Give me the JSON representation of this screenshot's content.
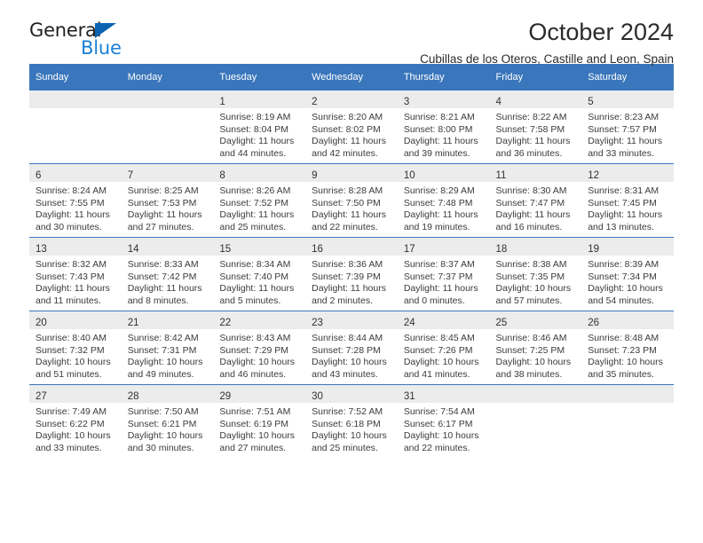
{
  "brand": {
    "name_top": "General",
    "name_bottom": "Blue",
    "triangle_icon": "triangle-icon",
    "colors": {
      "dark": "#231f20",
      "blue": "#1b7fd4",
      "triangle": "#0c63b0"
    }
  },
  "header": {
    "title": "October 2024",
    "subtitle": "Cubillas de los Oteros, Castille and Leon, Spain"
  },
  "theme": {
    "header_bg": "#3a76bb",
    "header_text": "#ffffff",
    "row_divider": "#3a76bb",
    "daynum_shade": "#ececec",
    "body_text": "#3b3b3b"
  },
  "calendar": {
    "weekday_headers": [
      "Sunday",
      "Monday",
      "Tuesday",
      "Wednesday",
      "Thursday",
      "Friday",
      "Saturday"
    ],
    "weeks": [
      [
        {
          "day": "",
          "lines": []
        },
        {
          "day": "",
          "lines": []
        },
        {
          "day": "1",
          "lines": [
            "Sunrise: 8:19 AM",
            "Sunset: 8:04 PM",
            "Daylight: 11 hours",
            "and 44 minutes."
          ]
        },
        {
          "day": "2",
          "lines": [
            "Sunrise: 8:20 AM",
            "Sunset: 8:02 PM",
            "Daylight: 11 hours",
            "and 42 minutes."
          ]
        },
        {
          "day": "3",
          "lines": [
            "Sunrise: 8:21 AM",
            "Sunset: 8:00 PM",
            "Daylight: 11 hours",
            "and 39 minutes."
          ]
        },
        {
          "day": "4",
          "lines": [
            "Sunrise: 8:22 AM",
            "Sunset: 7:58 PM",
            "Daylight: 11 hours",
            "and 36 minutes."
          ]
        },
        {
          "day": "5",
          "lines": [
            "Sunrise: 8:23 AM",
            "Sunset: 7:57 PM",
            "Daylight: 11 hours",
            "and 33 minutes."
          ]
        }
      ],
      [
        {
          "day": "6",
          "lines": [
            "Sunrise: 8:24 AM",
            "Sunset: 7:55 PM",
            "Daylight: 11 hours",
            "and 30 minutes."
          ]
        },
        {
          "day": "7",
          "lines": [
            "Sunrise: 8:25 AM",
            "Sunset: 7:53 PM",
            "Daylight: 11 hours",
            "and 27 minutes."
          ]
        },
        {
          "day": "8",
          "lines": [
            "Sunrise: 8:26 AM",
            "Sunset: 7:52 PM",
            "Daylight: 11 hours",
            "and 25 minutes."
          ]
        },
        {
          "day": "9",
          "lines": [
            "Sunrise: 8:28 AM",
            "Sunset: 7:50 PM",
            "Daylight: 11 hours",
            "and 22 minutes."
          ]
        },
        {
          "day": "10",
          "lines": [
            "Sunrise: 8:29 AM",
            "Sunset: 7:48 PM",
            "Daylight: 11 hours",
            "and 19 minutes."
          ]
        },
        {
          "day": "11",
          "lines": [
            "Sunrise: 8:30 AM",
            "Sunset: 7:47 PM",
            "Daylight: 11 hours",
            "and 16 minutes."
          ]
        },
        {
          "day": "12",
          "lines": [
            "Sunrise: 8:31 AM",
            "Sunset: 7:45 PM",
            "Daylight: 11 hours",
            "and 13 minutes."
          ]
        }
      ],
      [
        {
          "day": "13",
          "lines": [
            "Sunrise: 8:32 AM",
            "Sunset: 7:43 PM",
            "Daylight: 11 hours",
            "and 11 minutes."
          ]
        },
        {
          "day": "14",
          "lines": [
            "Sunrise: 8:33 AM",
            "Sunset: 7:42 PM",
            "Daylight: 11 hours",
            "and 8 minutes."
          ]
        },
        {
          "day": "15",
          "lines": [
            "Sunrise: 8:34 AM",
            "Sunset: 7:40 PM",
            "Daylight: 11 hours",
            "and 5 minutes."
          ]
        },
        {
          "day": "16",
          "lines": [
            "Sunrise: 8:36 AM",
            "Sunset: 7:39 PM",
            "Daylight: 11 hours",
            "and 2 minutes."
          ]
        },
        {
          "day": "17",
          "lines": [
            "Sunrise: 8:37 AM",
            "Sunset: 7:37 PM",
            "Daylight: 11 hours",
            "and 0 minutes."
          ]
        },
        {
          "day": "18",
          "lines": [
            "Sunrise: 8:38 AM",
            "Sunset: 7:35 PM",
            "Daylight: 10 hours",
            "and 57 minutes."
          ]
        },
        {
          "day": "19",
          "lines": [
            "Sunrise: 8:39 AM",
            "Sunset: 7:34 PM",
            "Daylight: 10 hours",
            "and 54 minutes."
          ]
        }
      ],
      [
        {
          "day": "20",
          "lines": [
            "Sunrise: 8:40 AM",
            "Sunset: 7:32 PM",
            "Daylight: 10 hours",
            "and 51 minutes."
          ]
        },
        {
          "day": "21",
          "lines": [
            "Sunrise: 8:42 AM",
            "Sunset: 7:31 PM",
            "Daylight: 10 hours",
            "and 49 minutes."
          ]
        },
        {
          "day": "22",
          "lines": [
            "Sunrise: 8:43 AM",
            "Sunset: 7:29 PM",
            "Daylight: 10 hours",
            "and 46 minutes."
          ]
        },
        {
          "day": "23",
          "lines": [
            "Sunrise: 8:44 AM",
            "Sunset: 7:28 PM",
            "Daylight: 10 hours",
            "and 43 minutes."
          ]
        },
        {
          "day": "24",
          "lines": [
            "Sunrise: 8:45 AM",
            "Sunset: 7:26 PM",
            "Daylight: 10 hours",
            "and 41 minutes."
          ]
        },
        {
          "day": "25",
          "lines": [
            "Sunrise: 8:46 AM",
            "Sunset: 7:25 PM",
            "Daylight: 10 hours",
            "and 38 minutes."
          ]
        },
        {
          "day": "26",
          "lines": [
            "Sunrise: 8:48 AM",
            "Sunset: 7:23 PM",
            "Daylight: 10 hours",
            "and 35 minutes."
          ]
        }
      ],
      [
        {
          "day": "27",
          "lines": [
            "Sunrise: 7:49 AM",
            "Sunset: 6:22 PM",
            "Daylight: 10 hours",
            "and 33 minutes."
          ]
        },
        {
          "day": "28",
          "lines": [
            "Sunrise: 7:50 AM",
            "Sunset: 6:21 PM",
            "Daylight: 10 hours",
            "and 30 minutes."
          ]
        },
        {
          "day": "29",
          "lines": [
            "Sunrise: 7:51 AM",
            "Sunset: 6:19 PM",
            "Daylight: 10 hours",
            "and 27 minutes."
          ]
        },
        {
          "day": "30",
          "lines": [
            "Sunrise: 7:52 AM",
            "Sunset: 6:18 PM",
            "Daylight: 10 hours",
            "and 25 minutes."
          ]
        },
        {
          "day": "31",
          "lines": [
            "Sunrise: 7:54 AM",
            "Sunset: 6:17 PM",
            "Daylight: 10 hours",
            "and 22 minutes."
          ]
        },
        {
          "day": "",
          "lines": []
        },
        {
          "day": "",
          "lines": []
        }
      ]
    ]
  }
}
